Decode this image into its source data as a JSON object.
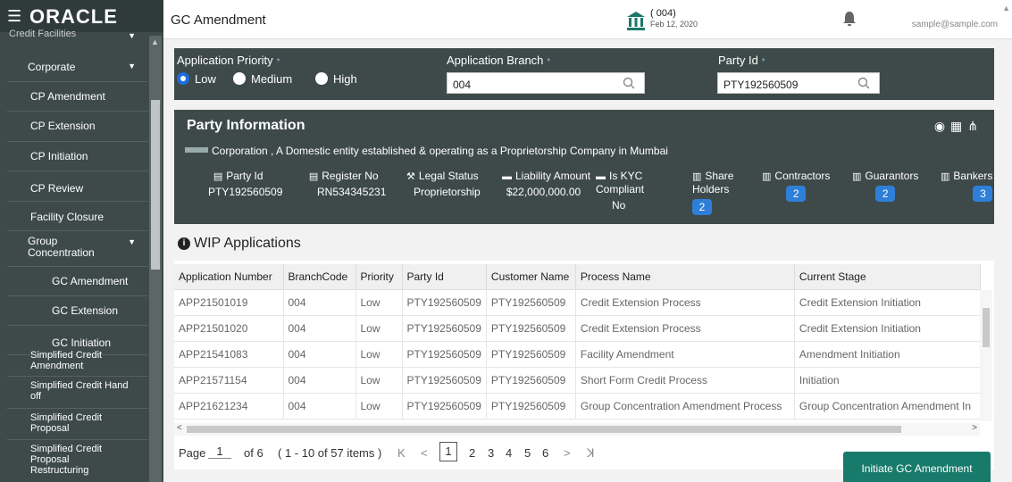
{
  "sidebar": {
    "brand": "ORACLE",
    "items": [
      {
        "label": "Credit Facilities",
        "caret": "▼"
      },
      {
        "label": "Corporate",
        "caret": "▼"
      },
      {
        "label": "CP Amendment"
      },
      {
        "label": "CP Extension"
      },
      {
        "label": "CP Initiation"
      },
      {
        "label": "CP Review"
      },
      {
        "label": "Facility Closure"
      },
      {
        "label": "Group Concentration",
        "caret": "▼"
      },
      {
        "label": "GC Amendment"
      },
      {
        "label": "GC Extension"
      },
      {
        "label": "GC Initiation"
      },
      {
        "label": "Simplified Credit Amendment"
      },
      {
        "label": "Simplified Credit Hand off"
      },
      {
        "label": "Simplified Credit Proposal"
      },
      {
        "label": "Simplified Credit Proposal Restructuring"
      }
    ]
  },
  "topbar": {
    "title": "GC Amendment",
    "branch": "( 004)",
    "date": "Feb 12, 2020",
    "user_name": "",
    "email": "sample@sample.com"
  },
  "filter": {
    "priority_label": "Application Priority",
    "priority_options": [
      "Low",
      "Medium",
      "High"
    ],
    "selected_priority": "Low",
    "branch_label": "Application Branch",
    "branch_value": "004",
    "party_label": "Party Id",
    "party_value": "PTY192560509",
    "required_mark": "*"
  },
  "party_info": {
    "title": "Party Information",
    "description": "Corporation , A Domestic entity established & operating as a Proprietorship Company in Mumbai",
    "fields": [
      {
        "label": "Party Id",
        "value": "PTY192560509"
      },
      {
        "label": "Register No",
        "value": "RN534345231"
      },
      {
        "label": "Legal Status",
        "value": "Proprietorship"
      },
      {
        "label": "Liability Amount",
        "value": "$22,000,000.00"
      },
      {
        "label": "Is KYC Compliant",
        "value": "No"
      },
      {
        "label": "Share Holders",
        "value": "2"
      },
      {
        "label": "Contractors",
        "value": "2"
      },
      {
        "label": "Guarantors",
        "value": "2"
      },
      {
        "label": "Bankers",
        "value": "3"
      }
    ]
  },
  "wip": {
    "title": "WIP Applications",
    "columns": [
      "Application Number",
      "BranchCode",
      "Priority",
      "Party Id",
      "Customer Name",
      "Process Name",
      "Current Stage"
    ],
    "rows": [
      [
        "APP21501019",
        "004",
        "Low",
        "PTY192560509",
        "PTY192560509",
        "Credit Extension Process",
        "Credit Extension Initiation"
      ],
      [
        "APP21501020",
        "004",
        "Low",
        "PTY192560509",
        "PTY192560509",
        "Credit Extension Process",
        "Credit Extension Initiation"
      ],
      [
        "APP21541083",
        "004",
        "Low",
        "PTY192560509",
        "PTY192560509",
        "Facility Amendment",
        "Amendment Initiation"
      ],
      [
        "APP21571154",
        "004",
        "Low",
        "PTY192560509",
        "PTY192560509",
        "Short Form Credit Process",
        "Initiation"
      ],
      [
        "APP21621234",
        "004",
        "Low",
        "PTY192560509",
        "PTY192560509",
        "Group Concentration Amendment Process",
        "Group Concentration Amendment In"
      ]
    ]
  },
  "pager": {
    "page_label": "Page",
    "page_value": "1",
    "of_text": "of 6",
    "items_text": "( 1 - 10 of 57 items )",
    "pages": [
      "1",
      "2",
      "3",
      "4",
      "5",
      "6"
    ],
    "first": "K",
    "prev": "<",
    "next": ">",
    "last": "ꓘ"
  },
  "actions": {
    "initiate_label": "Initiate GC Amendment"
  },
  "colors": {
    "sidebar_bg": "#3e4a4a",
    "accent_blue": "#2e7fd8",
    "button_green": "#177a6a"
  }
}
